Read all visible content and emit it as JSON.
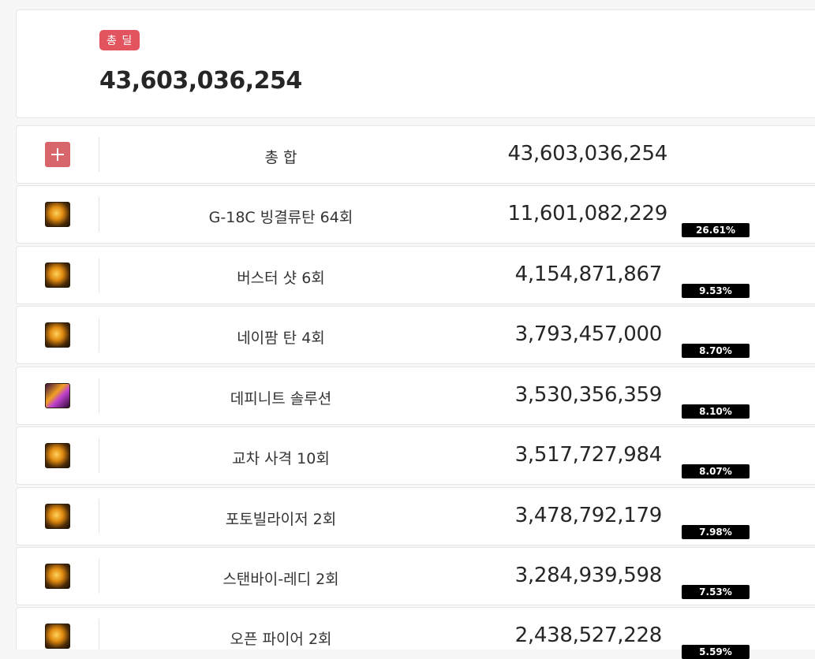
{
  "summary": {
    "badge_label": "총 딜",
    "total_value": "43,603,036,254"
  },
  "rows": [
    {
      "name": "총 합",
      "damage": "43,603,036,254",
      "percent": "",
      "icon": "plus-icon"
    },
    {
      "name": "G-18C 빙결류탄 64회",
      "damage": "11,601,082,229",
      "percent": "26.61%",
      "icon": "grenade-icon"
    },
    {
      "name": "버스터 샷 6회",
      "damage": "4,154,871,867",
      "percent": "9.53%",
      "icon": "buster-shot-icon"
    },
    {
      "name": "네이팜 탄 4회",
      "damage": "3,793,457,000",
      "percent": "8.70%",
      "icon": "napalm-icon"
    },
    {
      "name": "데피니트 솔루션",
      "damage": "3,530,356,359",
      "percent": "8.10%",
      "icon": "definite-solution-icon"
    },
    {
      "name": "교차 사격 10회",
      "damage": "3,517,727,984",
      "percent": "8.07%",
      "icon": "cross-fire-icon"
    },
    {
      "name": "포토빌라이저 2회",
      "damage": "3,478,792,179",
      "percent": "7.98%",
      "icon": "photovilizer-icon"
    },
    {
      "name": "스탠바이-레디 2회",
      "damage": "3,284,939,598",
      "percent": "7.53%",
      "icon": "standby-ready-icon"
    },
    {
      "name": "오픈 파이어 2회",
      "damage": "2,438,527,228",
      "percent": "5.59%",
      "icon": "open-fire-icon"
    }
  ]
}
